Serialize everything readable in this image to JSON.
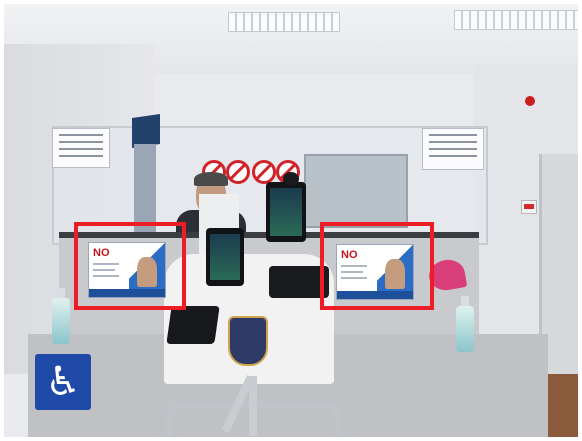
{
  "image": {
    "scene": "airport-immigration-counter",
    "accent_highlight_color": "#ee1c25",
    "poster_logo_text": "NO",
    "accessibility_icon": "wheelchair-icon"
  }
}
